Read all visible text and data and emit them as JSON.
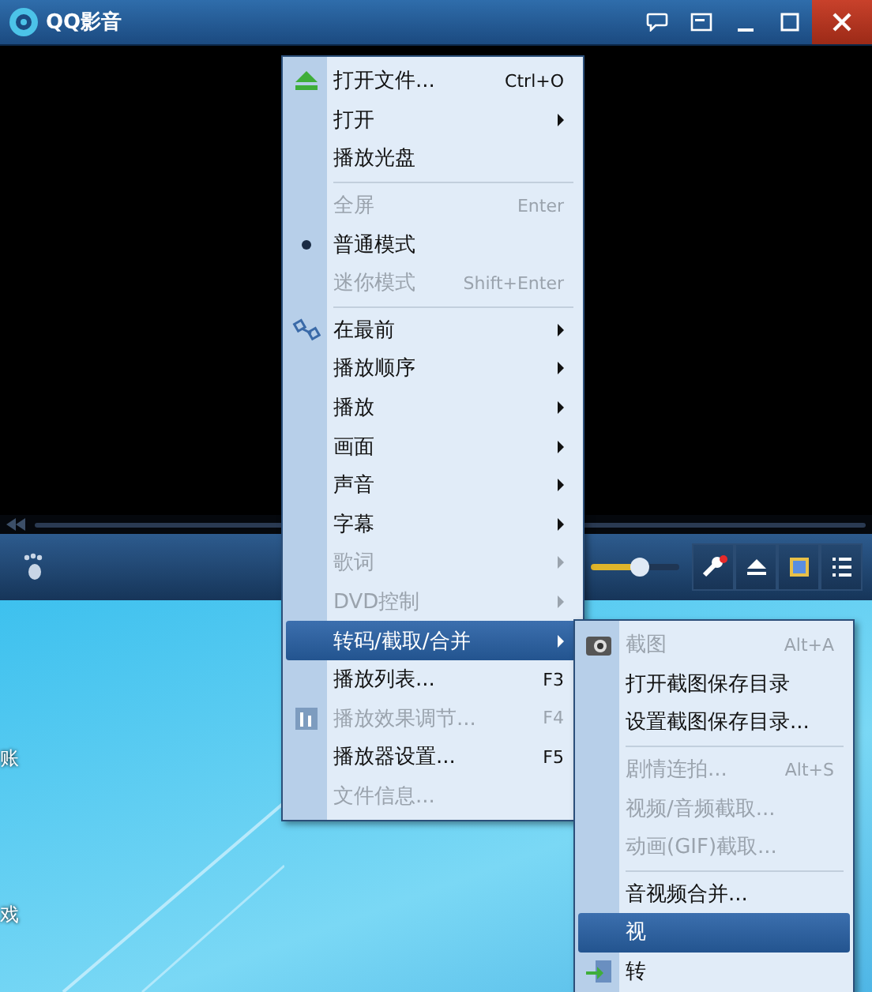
{
  "window": {
    "title": "QQ影音"
  },
  "player": {
    "volume": {
      "level": 0.55
    }
  },
  "desktop_labels": [
    "账",
    "戏"
  ],
  "menu": [
    {
      "kind": "item",
      "label": "打开文件...",
      "shortcut": "Ctrl+O",
      "disabled": false,
      "submenu": false,
      "checked": false,
      "selected": false
    },
    {
      "kind": "item",
      "label": "打开",
      "disabled": false,
      "submenu": true,
      "checked": false,
      "selected": false
    },
    {
      "kind": "item",
      "label": "播放光盘",
      "disabled": false,
      "submenu": false,
      "checked": false,
      "selected": false
    },
    {
      "kind": "separator"
    },
    {
      "kind": "item",
      "label": "全屏",
      "shortcut": "Enter",
      "disabled": true,
      "submenu": false,
      "checked": false,
      "selected": false
    },
    {
      "kind": "item",
      "label": "普通模式",
      "disabled": false,
      "submenu": false,
      "checked": true,
      "selected": false
    },
    {
      "kind": "item",
      "label": "迷你模式",
      "shortcut": "Shift+Enter",
      "disabled": true,
      "submenu": false,
      "checked": false,
      "selected": false
    },
    {
      "kind": "separator"
    },
    {
      "kind": "item",
      "label": "在最前",
      "disabled": false,
      "submenu": true,
      "checked": false,
      "selected": false
    },
    {
      "kind": "item",
      "label": "播放顺序",
      "disabled": false,
      "submenu": true,
      "checked": false,
      "selected": false
    },
    {
      "kind": "item",
      "label": "播放",
      "disabled": false,
      "submenu": true,
      "checked": false,
      "selected": false
    },
    {
      "kind": "item",
      "label": "画面",
      "disabled": false,
      "submenu": true,
      "checked": false,
      "selected": false
    },
    {
      "kind": "item",
      "label": "声音",
      "disabled": false,
      "submenu": true,
      "checked": false,
      "selected": false
    },
    {
      "kind": "item",
      "label": "字幕",
      "disabled": false,
      "submenu": true,
      "checked": false,
      "selected": false
    },
    {
      "kind": "item",
      "label": "歌词",
      "disabled": true,
      "submenu": true,
      "checked": false,
      "selected": false
    },
    {
      "kind": "item",
      "label": "DVD控制",
      "disabled": true,
      "submenu": true,
      "checked": false,
      "selected": false
    },
    {
      "kind": "item",
      "label": "转码/截取/合并",
      "disabled": false,
      "submenu": true,
      "checked": false,
      "selected": true
    },
    {
      "kind": "item",
      "label": "播放列表...",
      "shortcut": "F3",
      "disabled": false,
      "submenu": false,
      "checked": false,
      "selected": false
    },
    {
      "kind": "item",
      "label": "播放效果调节...",
      "shortcut": "F4",
      "disabled": true,
      "submenu": false,
      "checked": false,
      "selected": false
    },
    {
      "kind": "item",
      "label": "播放器设置...",
      "shortcut": "F5",
      "disabled": false,
      "submenu": false,
      "checked": false,
      "selected": false
    },
    {
      "kind": "item",
      "label": "文件信息...",
      "disabled": true,
      "submenu": false,
      "checked": false,
      "selected": false
    }
  ],
  "submenu": [
    {
      "kind": "item",
      "label": "截图",
      "shortcut": "Alt+A",
      "disabled": true,
      "selected": false
    },
    {
      "kind": "item",
      "label": "打开截图保存目录",
      "disabled": false,
      "selected": false
    },
    {
      "kind": "item",
      "label": "设置截图保存目录...",
      "disabled": false,
      "selected": false
    },
    {
      "kind": "separator"
    },
    {
      "kind": "item",
      "label": "剧情连拍...",
      "shortcut": "Alt+S",
      "disabled": true,
      "selected": false
    },
    {
      "kind": "item",
      "label": "视频/音频截取...",
      "disabled": true,
      "selected": false
    },
    {
      "kind": "item",
      "label": "动画(GIF)截取...",
      "disabled": true,
      "selected": false
    },
    {
      "kind": "separator"
    },
    {
      "kind": "item",
      "label": "音视频合并...",
      "disabled": false,
      "selected": false
    },
    {
      "kind": "item",
      "label": "视",
      "disabled": false,
      "selected": true
    },
    {
      "kind": "item",
      "label": "转",
      "disabled": false,
      "selected": false
    }
  ]
}
